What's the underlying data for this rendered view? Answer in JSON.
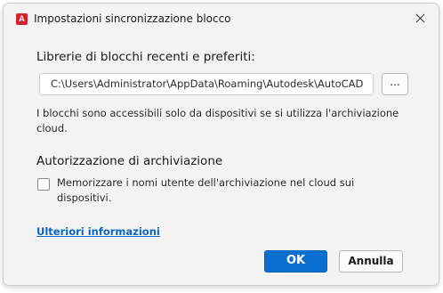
{
  "window": {
    "title": "Impostazioni sincronizzazione blocco",
    "app_icon_letter": "A",
    "close_icon": "close-icon"
  },
  "libraries": {
    "heading": "Librerie di blocchi recenti e preferiti:",
    "path_value": "C:\\Users\\Administrator\\AppData\\Roaming\\Autodesk\\AutoCAD",
    "browse_label": "...",
    "info_text": "I blocchi sono accessibili solo da dispositivi se si utilizza l'archiviazione cloud."
  },
  "storage": {
    "heading": "Autorizzazione di archiviazione",
    "checkbox_checked": false,
    "checkbox_label": "Memorizzare i nomi utente dell'archiviazione nel cloud sui dispositivi."
  },
  "footer": {
    "more_info_link": "Ulteriori informazioni",
    "ok_label": "OK",
    "cancel_label": "Annulla"
  },
  "colors": {
    "primary_button": "#0a6fd1",
    "link": "#0b66c3",
    "app_icon": "#d6222f",
    "dialog_background": "#f3f3f3"
  }
}
